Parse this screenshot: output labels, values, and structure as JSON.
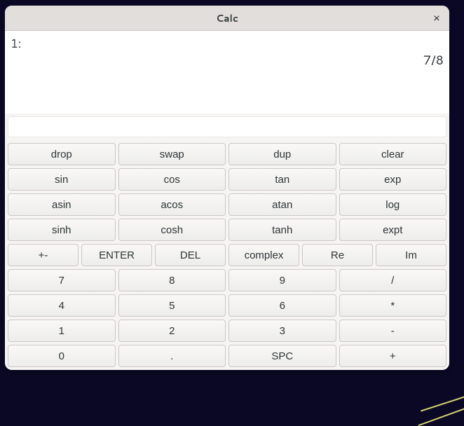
{
  "window": {
    "title": "Calc",
    "close_label": "×"
  },
  "stack": {
    "line_index": "1:",
    "value": "7/8"
  },
  "input": {
    "value": ""
  },
  "rows": {
    "r0": {
      "c0": "drop",
      "c1": "swap",
      "c2": "dup",
      "c3": "clear"
    },
    "r1": {
      "c0": "sin",
      "c1": "cos",
      "c2": "tan",
      "c3": "exp"
    },
    "r2": {
      "c0": "asin",
      "c1": "acos",
      "c2": "atan",
      "c3": "log"
    },
    "r3": {
      "c0": "sinh",
      "c1": "cosh",
      "c2": "tanh",
      "c3": "expt"
    },
    "r4": {
      "c0": "+-",
      "c1": "ENTER",
      "c2": "DEL",
      "c3": "complex",
      "c4": "Re",
      "c5": "Im"
    },
    "r5": {
      "c0": "7",
      "c1": "8",
      "c2": "9",
      "c3": "/"
    },
    "r6": {
      "c0": "4",
      "c1": "5",
      "c2": "6",
      "c3": "*"
    },
    "r7": {
      "c0": "1",
      "c1": "2",
      "c2": "3",
      "c3": "-"
    },
    "r8": {
      "c0": "0",
      "c1": ".",
      "c2": "SPC",
      "c3": "+"
    }
  }
}
